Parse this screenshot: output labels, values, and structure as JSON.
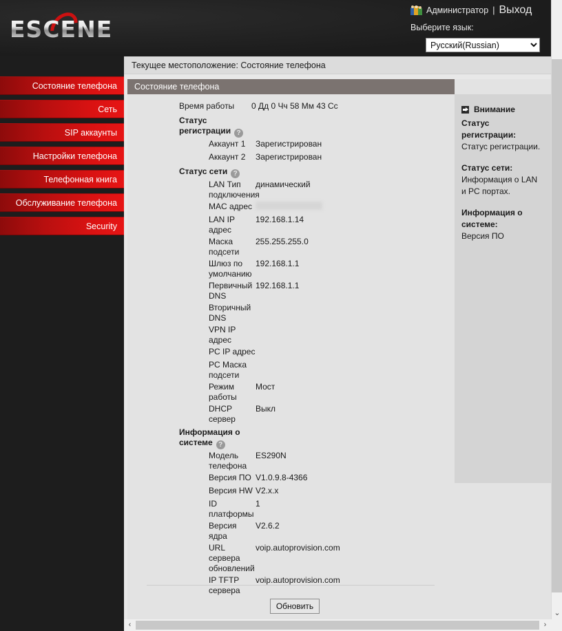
{
  "header": {
    "logo_text": "ESCENE",
    "user_icon": "users-icon",
    "user_label": "Администратор",
    "separator": "|",
    "logout_label": "Выход",
    "language_label": "Выберите язык:",
    "language_selected": "Русский(Russian)",
    "language_options": [
      "Русский(Russian)"
    ]
  },
  "sidebar": {
    "items": [
      {
        "label": "Состояние телефона"
      },
      {
        "label": "Сеть"
      },
      {
        "label": "SIP аккаунты"
      },
      {
        "label": "Настройки телефона"
      },
      {
        "label": "Телефонная книга"
      },
      {
        "label": "Обслуживание телефона"
      },
      {
        "label": "Security"
      }
    ]
  },
  "breadcrumb": "Текущее местоположение: Состояние телефона",
  "panel": {
    "title": "Состояние телефона",
    "uptime_label": "Время работы",
    "uptime_value": "0 Дд 0 Чч 58 Мм 43 Сс",
    "sections": [
      {
        "heading": "Статус регистрации",
        "rows": [
          {
            "label": "Аккаунт 1",
            "value": "Зарегистрирован"
          },
          {
            "label": "Аккаунт 2",
            "value": "Зарегистрирован"
          }
        ]
      },
      {
        "heading": "Статус сети",
        "rows": [
          {
            "label": "LAN Тип подключения",
            "value": "динамический"
          },
          {
            "label": "MAC адрес",
            "value": "",
            "redacted": true
          },
          {
            "label": "LAN IP адрес",
            "value": "192.168.1.14"
          },
          {
            "label": "Маска подсети",
            "value": "255.255.255.0"
          },
          {
            "label": "Шлюз по умолчанию",
            "value": "192.168.1.1"
          },
          {
            "label": "Первичный DNS",
            "value": "192.168.1.1"
          },
          {
            "label": "Вторичный DNS",
            "value": ""
          },
          {
            "label": "VPN IP адрес",
            "value": ""
          },
          {
            "label": "PC IP адрес",
            "value": ""
          },
          {
            "label": "PC Маска подсети",
            "value": ""
          },
          {
            "label": "Режим работы",
            "value": "Мост"
          },
          {
            "label": "DHCP сервер",
            "value": "Выкл"
          }
        ]
      },
      {
        "heading": "Информация о системе",
        "rows": [
          {
            "label": "Модель телефона",
            "value": "ES290N"
          },
          {
            "label": "Версия ПО",
            "value": "V1.0.9.8-4366"
          },
          {
            "label": "Версия HW",
            "value": "V2.x.x"
          },
          {
            "label": "ID платформы",
            "value": "1"
          },
          {
            "label": "Версия ядра",
            "value": "V2.6.2"
          },
          {
            "label": "URL сервера обновлений",
            "value": "voip.autoprovision.com"
          },
          {
            "label": "IP TFTP сервера",
            "value": "voip.autoprovision.com"
          }
        ]
      }
    ],
    "refresh_label": "Обновить"
  },
  "help": {
    "attn_icon": "attention-icon",
    "attn_title": "Внимание",
    "blocks": [
      {
        "title": "Статус регистрации:",
        "text": "Статус регистрации."
      },
      {
        "title": "Статус сети:",
        "text": "Информация о LAN и PC портах."
      },
      {
        "title": "Информация о системе:",
        "text": "Версия ПО"
      }
    ]
  },
  "scrollbars": {
    "left_arrow": "‹",
    "right_arrow": "›",
    "down_arrow": "⌄"
  },
  "colors": {
    "accent_red": "#cc1111",
    "panel_title_bg": "#7b7370",
    "content_bg": "#e3e3e3",
    "help_bg": "#d4d4d4"
  }
}
